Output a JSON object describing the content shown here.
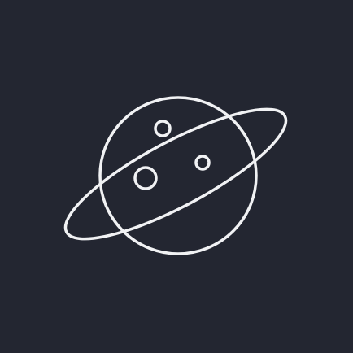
{
  "app": {
    "background_color": "#232631",
    "stroke_color": "#f1f2f4"
  },
  "icon": {
    "name": "planet-icon"
  }
}
